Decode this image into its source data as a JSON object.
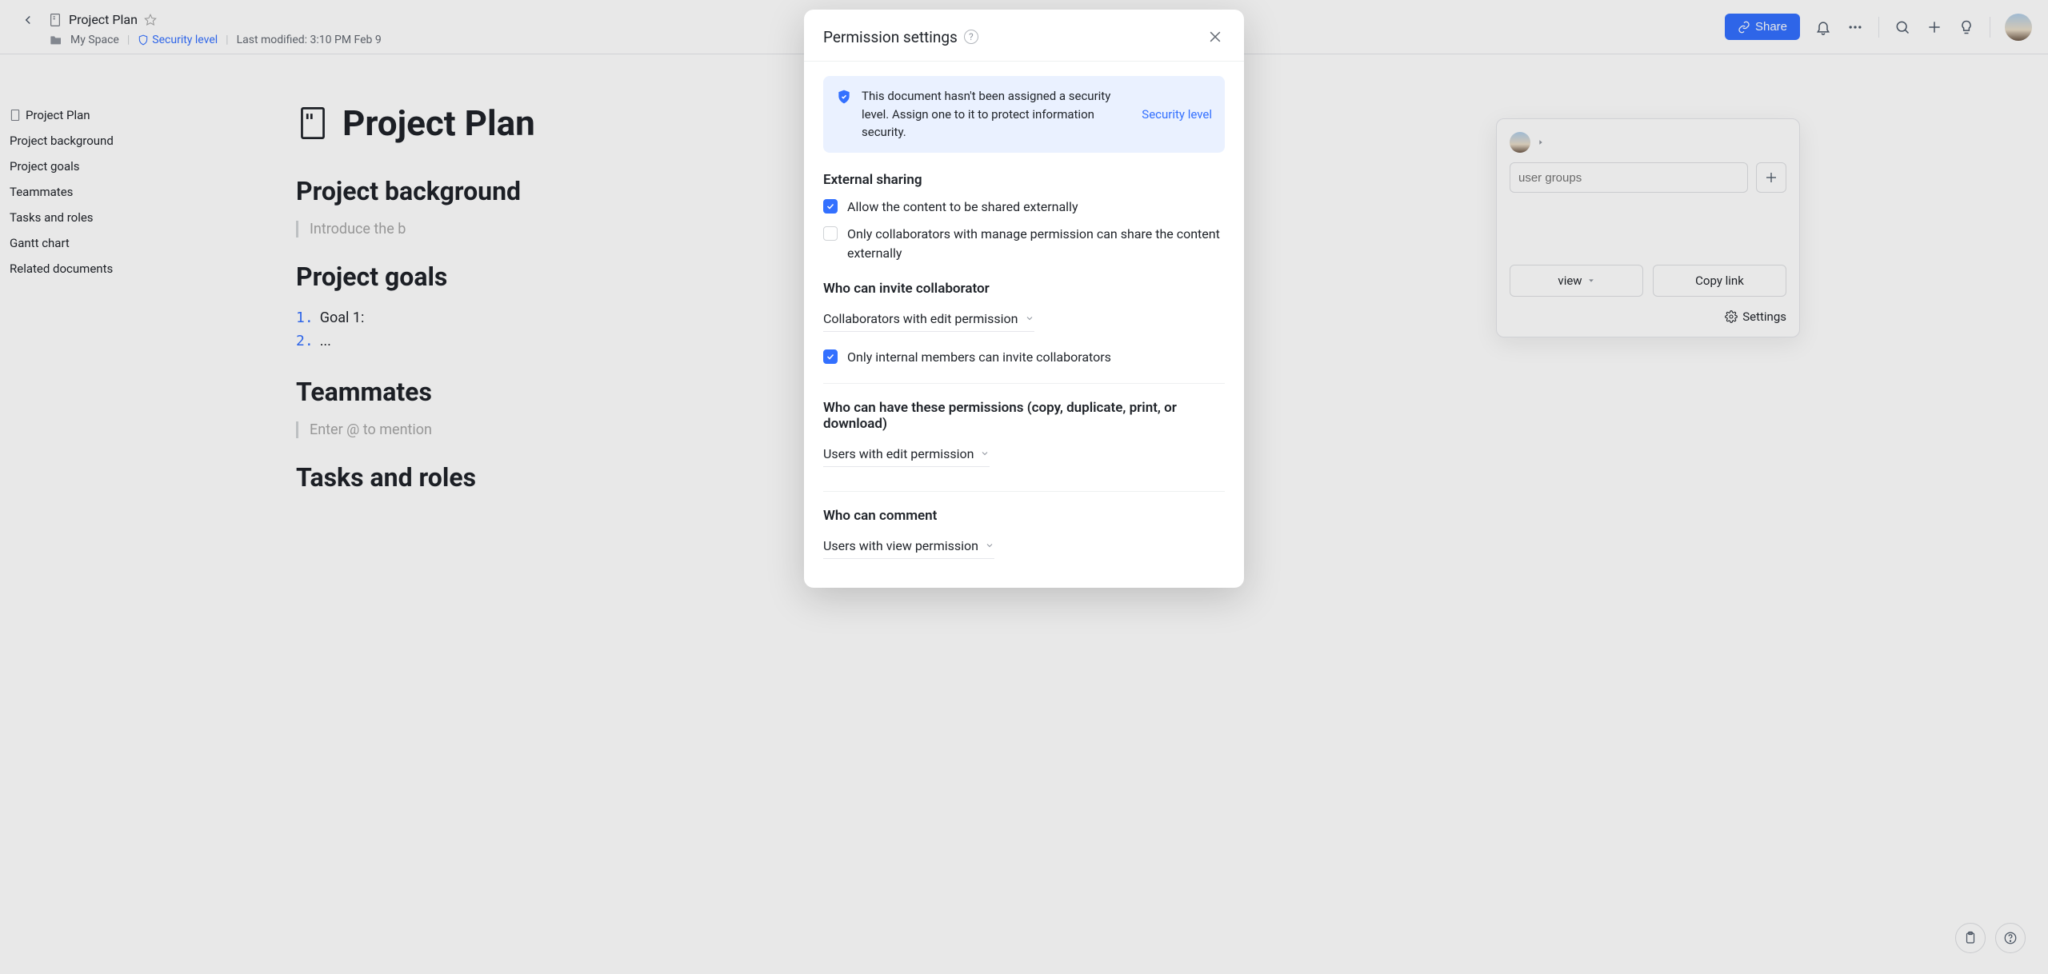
{
  "header": {
    "doc_title": "Project Plan",
    "breadcrumb_space": "My Space",
    "security_level_label": "Security level",
    "last_modified": "Last modified: 3:10 PM Feb 9",
    "share_button": "Share"
  },
  "outline": {
    "items": [
      "Project Plan",
      "Project background",
      "Project goals",
      "Teammates",
      "Tasks and roles",
      "Gantt chart",
      "Related documents"
    ]
  },
  "doc": {
    "title": "Project Plan",
    "h_background": "Project background",
    "placeholder_background": "Introduce the b",
    "h_goals": "Project goals",
    "goals": [
      {
        "num": "1.",
        "text": "Goal 1:"
      },
      {
        "num": "2.",
        "text": "..."
      }
    ],
    "h_teammates": "Teammates",
    "placeholder_teammates": "Enter @ to mention",
    "h_tasks": "Tasks and roles"
  },
  "share_card": {
    "input_placeholder": "user groups",
    "view_label": "view",
    "copy_link_label": "Copy link",
    "settings_label": "Settings"
  },
  "modal": {
    "title": "Permission settings",
    "banner_text": "This document hasn't been assigned a security level. Assign one to it to protect information security.",
    "banner_link": "Security level",
    "section_external": "External sharing",
    "chk_allow_external": "Allow the content to be shared externally",
    "chk_only_manage": "Only collaborators with manage permission can share the content externally",
    "section_invite": "Who can invite collaborator",
    "dd_invite": "Collaborators with edit permission",
    "chk_only_internal": "Only internal members can invite collaborators",
    "section_copy": "Who can have these permissions (copy, duplicate, print, or download)",
    "dd_copy": "Users with edit permission",
    "section_comment": "Who can comment",
    "dd_comment": "Users with view permission"
  }
}
